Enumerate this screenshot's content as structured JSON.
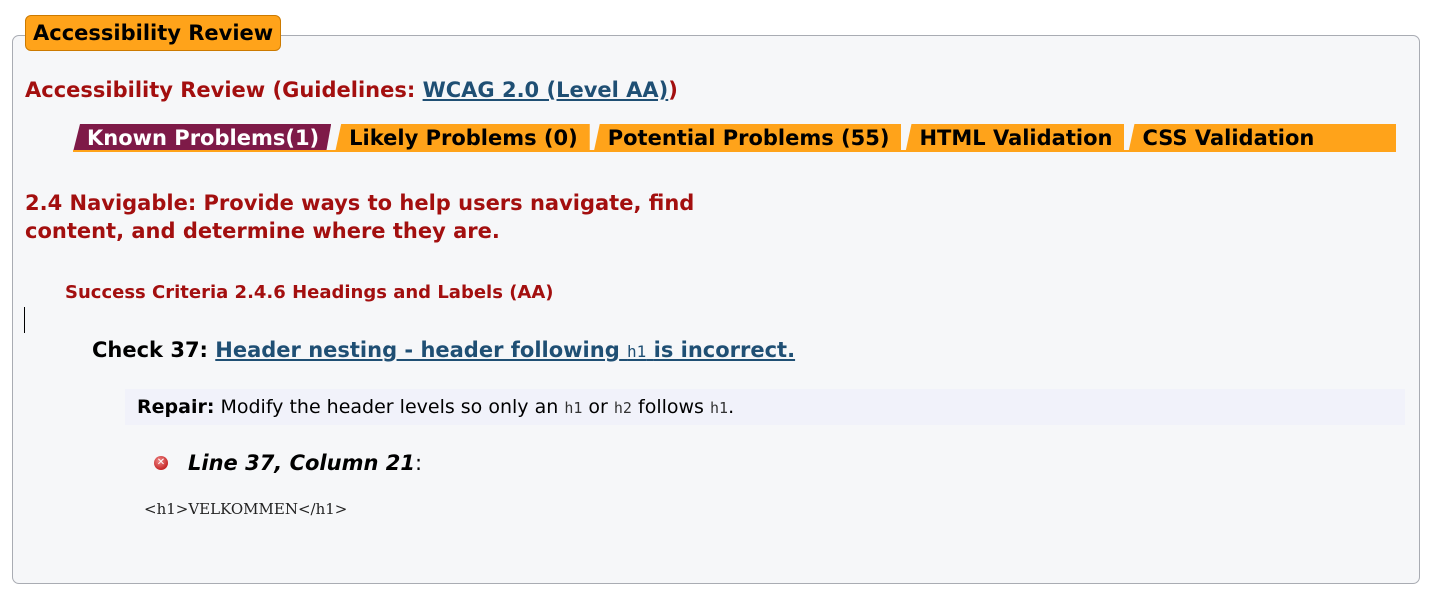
{
  "legend_title": "Accessibility Review",
  "review": {
    "title_prefix": "Accessibility Review (Guidelines: ",
    "guideline_link": "WCAG 2.0 (Level AA)",
    "title_suffix": ")"
  },
  "tabs": [
    {
      "label": "Known Problems(1)",
      "active": true
    },
    {
      "label": "Likely Problems (0)",
      "active": false
    },
    {
      "label": "Potential Problems (55)",
      "active": false
    },
    {
      "label": "HTML Validation",
      "active": false
    },
    {
      "label": "CSS Validation",
      "active": false
    }
  ],
  "section_heading": "2.4 Navigable: Provide ways to help users navigate, find content, and determine where they are.",
  "criteria": "Success Criteria 2.4.6 Headings and Labels (AA)",
  "check": {
    "label": "Check 37:",
    "link_pre": "Header nesting - header following",
    "link_code": "h1",
    "link_post": "is incorrect."
  },
  "repair": {
    "label": "Repair:",
    "text1": "Modify the header levels so only an",
    "code1": "h1",
    "text2": "or",
    "code2": "h2",
    "text3": "follows",
    "code3": "h1",
    "text4": "."
  },
  "error": {
    "icon": "error-circle-icon",
    "location": "Line 37, Column 21",
    "colon": ":"
  },
  "code_snippet": "<h1>VELKOMMEN</h1>",
  "colors": {
    "accent_orange": "#ffa31a",
    "active_tab": "#7e1a48",
    "heading_red": "#a30f0f",
    "link_blue": "#1f4f74"
  }
}
